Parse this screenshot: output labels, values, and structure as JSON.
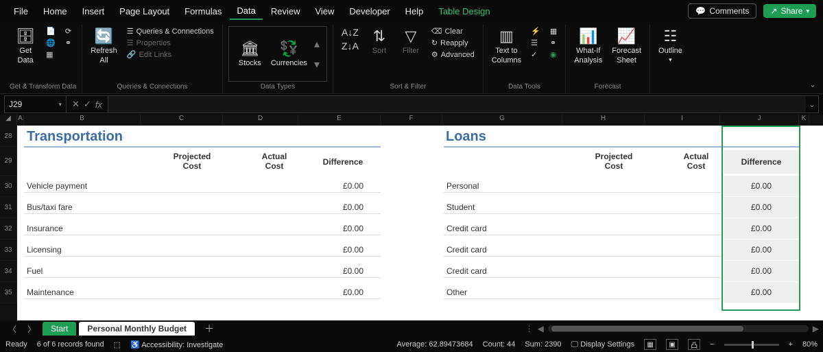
{
  "menu": {
    "items": [
      "File",
      "Home",
      "Insert",
      "Page Layout",
      "Formulas",
      "Data",
      "Review",
      "View",
      "Developer",
      "Help",
      "Table Design"
    ],
    "comments": "Comments",
    "share": "Share"
  },
  "ribbon": {
    "get_data": "Get\nData",
    "refresh": "Refresh\nAll",
    "queries": "Queries & Connections",
    "properties": "Properties",
    "edit_links": "Edit Links",
    "stocks": "Stocks",
    "currencies": "Currencies",
    "sort": "Sort",
    "filter": "Filter",
    "clear": "Clear",
    "reapply": "Reapply",
    "advanced": "Advanced",
    "text_to_cols": "Text to\nColumns",
    "whatif": "What-If\nAnalysis",
    "forecast_sheet": "Forecast\nSheet",
    "outline": "Outline",
    "groups": {
      "get_transform": "Get & Transform Data",
      "queries_conn": "Queries & Connections",
      "data_types": "Data Types",
      "sort_filter": "Sort & Filter",
      "data_tools": "Data Tools",
      "forecast": "Forecast"
    }
  },
  "namebox": "J29",
  "columns": [
    "A",
    "B",
    "C",
    "D",
    "E",
    "F",
    "G",
    "H",
    "I",
    "J",
    "K"
  ],
  "rows": [
    "28",
    "29",
    "30",
    "31",
    "32",
    "33",
    "34",
    "35"
  ],
  "sections": {
    "transportation": {
      "title": "Transportation",
      "headers": {
        "projected": "Projected\nCost",
        "actual": "Actual\nCost",
        "difference": "Difference"
      },
      "items": [
        {
          "label": "Vehicle payment",
          "diff": "£0.00"
        },
        {
          "label": "Bus/taxi fare",
          "diff": "£0.00"
        },
        {
          "label": "Insurance",
          "diff": "£0.00"
        },
        {
          "label": "Licensing",
          "diff": "£0.00"
        },
        {
          "label": "Fuel",
          "diff": "£0.00"
        },
        {
          "label": "Maintenance",
          "diff": "£0.00"
        }
      ]
    },
    "loans": {
      "title": "Loans",
      "headers": {
        "projected": "Projected\nCost",
        "actual": "Actual\nCost",
        "difference": "Difference"
      },
      "items": [
        {
          "label": "Personal",
          "diff": "£0.00"
        },
        {
          "label": "Student",
          "diff": "£0.00"
        },
        {
          "label": "Credit card",
          "diff": "£0.00"
        },
        {
          "label": "Credit card",
          "diff": "£0.00"
        },
        {
          "label": "Credit card",
          "diff": "£0.00"
        },
        {
          "label": "Other",
          "diff": "£0.00"
        }
      ]
    }
  },
  "tabs": {
    "start": "Start",
    "budget": "Personal Monthly Budget"
  },
  "status": {
    "ready": "Ready",
    "records": "6 of 6 records found",
    "accessibility": "Accessibility: Investigate",
    "average": "Average: 62.89473684",
    "count": "Count: 44",
    "sum": "Sum: 2390",
    "display": "Display Settings",
    "zoom": "80%"
  }
}
